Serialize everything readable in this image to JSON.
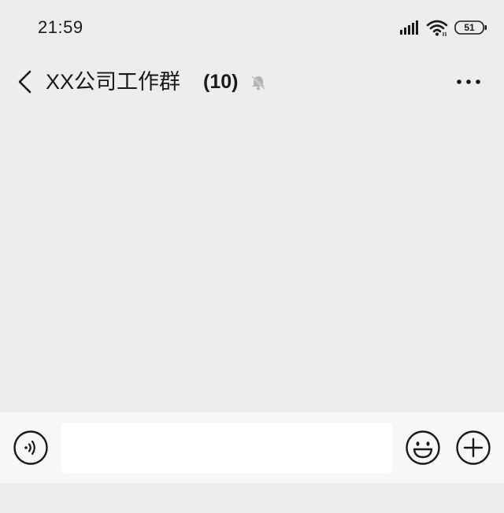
{
  "status_bar": {
    "time": "21:59",
    "battery_level": "51",
    "icons": [
      "signal-icon",
      "wifi-icon",
      "battery-icon"
    ]
  },
  "header": {
    "title": "XX公司工作群",
    "member_count": "(10)",
    "icons": [
      "back-icon",
      "mute-bell-icon",
      "more-icon"
    ]
  },
  "input_bar": {
    "text_value": "",
    "icons": [
      "voice-icon",
      "emoji-icon",
      "plus-icon"
    ]
  },
  "colors": {
    "background": "#ededed",
    "input_bar_background": "#f7f7f7",
    "text": "#191919",
    "muted_icon": "#b2b2b2"
  }
}
